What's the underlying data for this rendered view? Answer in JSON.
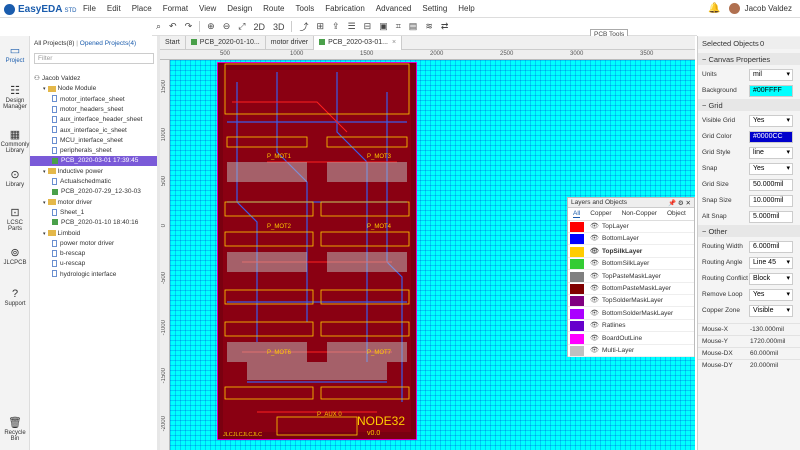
{
  "app": {
    "name": "EasyEDA",
    "edition": "STD"
  },
  "menu": [
    "File",
    "Edit",
    "Place",
    "Format",
    "View",
    "Design",
    "Route",
    "Tools",
    "Fabrication",
    "Advanced",
    "Setting",
    "Help"
  ],
  "user": {
    "name": "Jacob Valdez"
  },
  "tooltip": "PCB Tools",
  "leftnav": [
    {
      "icon": "folder-icon",
      "label": "Project"
    },
    {
      "icon": "design-manager-icon",
      "label": "Design Manager"
    },
    {
      "icon": "commonly-library-icon",
      "label": "Commonly Library"
    },
    {
      "icon": "library-icon",
      "label": "Library"
    },
    {
      "icon": "lcsc-icon",
      "label": "LCSC Parts"
    },
    {
      "icon": "jlcpcb-icon",
      "label": "JLCPCB"
    },
    {
      "icon": "support-icon",
      "label": "Support"
    },
    {
      "icon": "recycle-bin-icon",
      "label": "Recycle Bin"
    }
  ],
  "projects": {
    "all_tab": "All Projects(8)",
    "opened_tab": "Opened Projects(4)",
    "filter_placeholder": "Filter",
    "tree": [
      {
        "label": "Jacob Valdez",
        "type": "user",
        "level": 0
      },
      {
        "label": "Node Module",
        "type": "folder",
        "level": 1
      },
      {
        "label": "motor_interface_sheet",
        "type": "doc",
        "level": 2
      },
      {
        "label": "motor_headers_sheet",
        "type": "doc",
        "level": 2
      },
      {
        "label": "aux_interface_header_sheet",
        "type": "doc",
        "level": 2
      },
      {
        "label": "aux_interface_ic_sheet",
        "type": "doc",
        "level": 2
      },
      {
        "label": "MCU_interface_sheet",
        "type": "doc",
        "level": 2
      },
      {
        "label": "peripherals_sheet",
        "type": "doc",
        "level": 2
      },
      {
        "label": "PCB_2020-03-01 17:39:45",
        "type": "pcb",
        "level": 2,
        "selected": true
      },
      {
        "label": "Inductive power",
        "type": "folder",
        "level": 1
      },
      {
        "label": "Actualschedmatic",
        "type": "doc",
        "level": 2
      },
      {
        "label": "PCB_2020-07-29_12-30-03",
        "type": "pcb",
        "level": 2
      },
      {
        "label": "motor driver",
        "type": "folder",
        "level": 1
      },
      {
        "label": "Sheet_1",
        "type": "doc",
        "level": 2
      },
      {
        "label": "PCB_2020-01-10 18:40:16",
        "type": "pcb",
        "level": 2
      },
      {
        "label": "Limboid",
        "type": "folder",
        "level": 1
      },
      {
        "label": "power motor driver",
        "type": "doc",
        "level": 2
      },
      {
        "label": "b-rescap",
        "type": "doc",
        "level": 2
      },
      {
        "label": "u-rescap",
        "type": "doc",
        "level": 2
      },
      {
        "label": "hydrologic interface",
        "type": "doc",
        "level": 2
      }
    ]
  },
  "tabs": [
    {
      "label": "Start",
      "active": false,
      "pcb": false
    },
    {
      "label": "PCB_2020-01-10...",
      "active": false,
      "pcb": true
    },
    {
      "label": "motor driver",
      "active": false,
      "pcb": false
    },
    {
      "label": "PCB_2020-03-01...",
      "active": true,
      "pcb": true
    }
  ],
  "ruler": {
    "top": [
      "500",
      "1000",
      "1500",
      "2000",
      "2500",
      "3000",
      "3500"
    ],
    "left": [
      "1500",
      "1000",
      "500",
      "0",
      "-500",
      "-1000",
      "-1500",
      "-2000"
    ]
  },
  "board": {
    "title": "NODE32",
    "version": "v0.0",
    "mot_labels": [
      "P_MOT1",
      "P_MOT3",
      "P_MOT2",
      "P_MOT4",
      "P_MOT6",
      "P_MOT7"
    ],
    "bottom_text": "JLCJLCJLCJLC",
    "aux": "P_AUX 0"
  },
  "layers": {
    "title": "Layers and Objects",
    "tabs": [
      "All",
      "Copper",
      "Non-Copper",
      "Object"
    ],
    "rows": [
      {
        "name": "TopLayer",
        "color": "#ff0000"
      },
      {
        "name": "BottomLayer",
        "color": "#0000ff"
      },
      {
        "name": "TopSilkLayer",
        "color": "#ffcc00",
        "active": true
      },
      {
        "name": "BottomSilkLayer",
        "color": "#33cc33"
      },
      {
        "name": "TopPasteMaskLayer",
        "color": "#808080"
      },
      {
        "name": "BottomPasteMaskLayer",
        "color": "#800000"
      },
      {
        "name": "TopSolderMaskLayer",
        "color": "#800080"
      },
      {
        "name": "BottomSolderMaskLayer",
        "color": "#aa00ff"
      },
      {
        "name": "Ratlines",
        "color": "#6600cc"
      },
      {
        "name": "BoardOutLine",
        "color": "#ff00ff"
      },
      {
        "name": "Multi-Layer",
        "color": "#c0c0c0"
      }
    ]
  },
  "props": {
    "selected_label": "Selected Objects",
    "selected_count": "0",
    "canvas_title": "Canvas Properties",
    "units_label": "Units",
    "units": "mil",
    "background_label": "Background",
    "background": "#00FFFF",
    "grid_title": "Grid",
    "visible_grid_label": "Visible Grid",
    "visible_grid": "Yes",
    "grid_color_label": "Grid Color",
    "grid_color": "#0000CC",
    "grid_style_label": "Grid Style",
    "grid_style": "line",
    "snap_label": "Snap",
    "snap": "Yes",
    "grid_size_label": "Grid Size",
    "grid_size": "50.000mil",
    "snap_size_label": "Snap Size",
    "snap_size": "10.000mil",
    "alt_snap_label": "Alt Snap",
    "alt_snap": "5.000mil",
    "other_title": "Other",
    "routing_width_label": "Routing Width",
    "routing_width": "6.000mil",
    "routing_angle_label": "Routing Angle",
    "routing_angle": "Line 45",
    "routing_conflict_label": "Routing Conflict",
    "routing_conflict": "Block",
    "remove_loop_label": "Remove Loop",
    "remove_loop": "Yes",
    "copper_zone_label": "Copper Zone",
    "copper_zone": "Visible",
    "mouse_x_label": "Mouse-X",
    "mouse_x": "-130.000mil",
    "mouse_y_label": "Mouse-Y",
    "mouse_y": "1720.000mil",
    "mouse_dx_label": "Mouse-DX",
    "mouse_dx": "60.000mil",
    "mouse_dy_label": "Mouse-DY",
    "mouse_dy": "20.000mil"
  }
}
